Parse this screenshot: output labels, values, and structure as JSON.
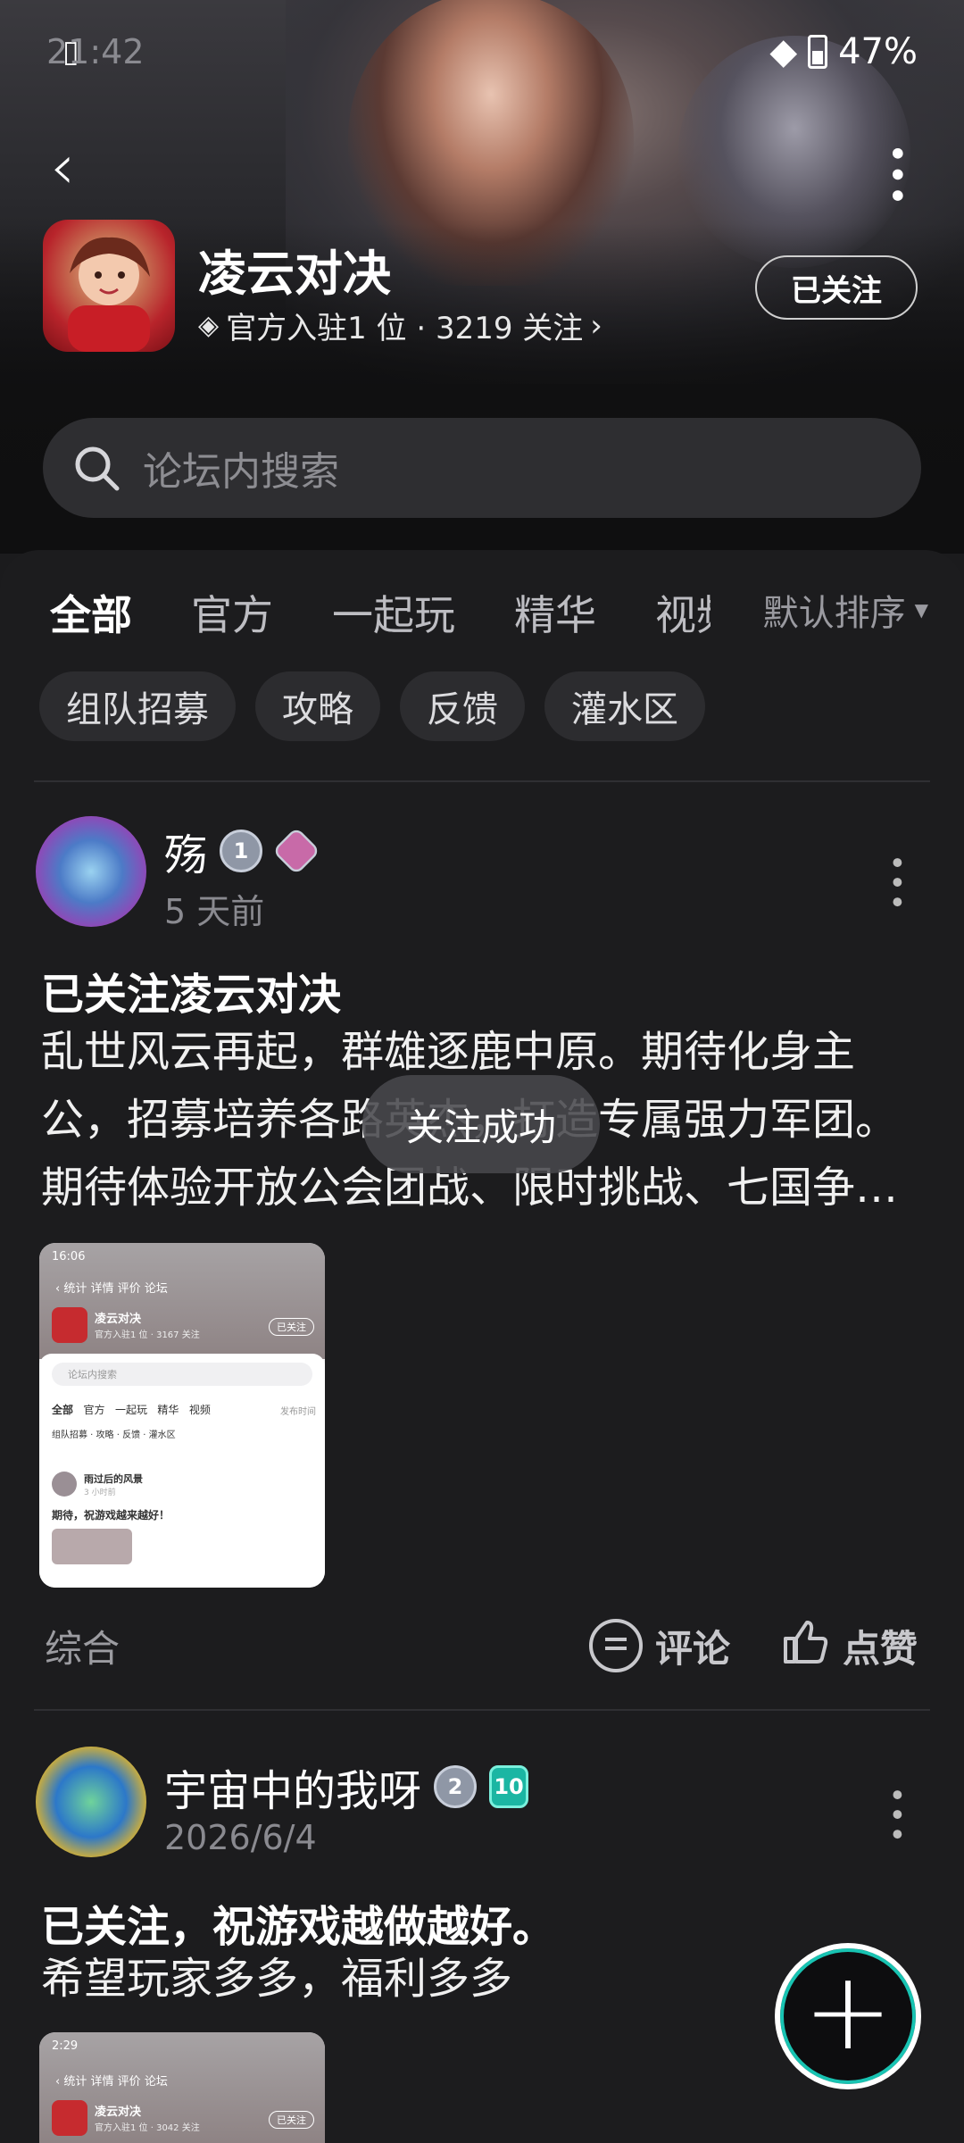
{
  "status_bar": {
    "time": "21:42",
    "battery": "47%"
  },
  "header": {
    "game_name": "凌云对决",
    "subtitle": "官方入驻1 位 · 3219 关注",
    "follow_label": "已关注"
  },
  "search": {
    "placeholder": "论坛内搜索"
  },
  "tabs": [
    "全部",
    "官方",
    "一起玩",
    "精华",
    "视频"
  ],
  "sort_label": "默认排序",
  "chips": [
    "组队招募",
    "攻略",
    "反馈",
    "灌水区"
  ],
  "toast": "关注成功",
  "posts": [
    {
      "username": "殇",
      "badge": "1",
      "time": "5 天前",
      "title": "已关注凌云对决",
      "body": "乱世风云再起，群雄逐鹿中原。期待化身主公，招募培养各路英杰，打造专属强力军团。期待体验开放公会团战、限时挑战、七国争霸等玩法",
      "category": "综合",
      "comment_label": "评论",
      "like_label": "点赞",
      "thumb": {
        "time": "16:06",
        "nav": [
          "统计",
          "详情",
          "评价",
          "论坛"
        ],
        "game": "凌云对决",
        "game_sub": "官方入驻1 位 · 3167 关注",
        "followed": "已关注",
        "search": "论坛内搜索",
        "tabs": [
          "全部",
          "官方",
          "一起玩",
          "精华",
          "视频"
        ],
        "sort": "发布时间",
        "chips": [
          "组队招募",
          "攻略",
          "反馈",
          "灌水区"
        ],
        "user": "雨过后的风景",
        "user_time": "3 小时前",
        "text": "期待，祝游戏越来越好！"
      }
    },
    {
      "username": "宇宙中的我呀",
      "badge": "2",
      "level": "10",
      "time": "2026/6/4",
      "title": "已关注，祝游戏越做越好。",
      "body": "希望玩家多多，福利多多",
      "thumb": {
        "time": "2:29",
        "nav": [
          "统计",
          "详情",
          "评价",
          "论坛"
        ],
        "game": "凌云对决",
        "game_sub": "官方入驻1 位 · 3042 关注",
        "followed": "已关注"
      }
    }
  ]
}
